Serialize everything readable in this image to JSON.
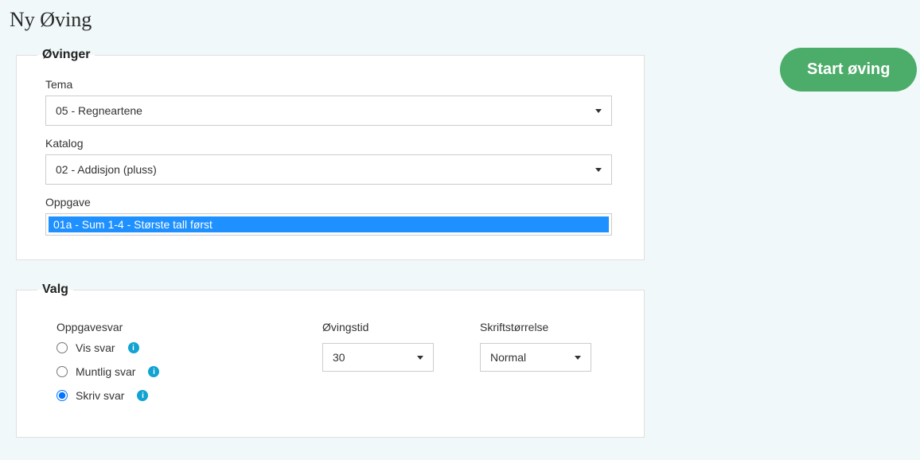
{
  "page": {
    "title": "Ny Øving"
  },
  "start_button": {
    "label": "Start øving"
  },
  "ovinger": {
    "legend": "Øvinger",
    "tema": {
      "label": "Tema",
      "value": "05 - Regneartene"
    },
    "katalog": {
      "label": "Katalog",
      "value": "02 - Addisjon (pluss)"
    },
    "oppgave": {
      "label": "Oppgave",
      "selected": "01a - Sum 1-4 - Største tall først"
    }
  },
  "valg": {
    "legend": "Valg",
    "oppgavesvar": {
      "heading": "Oppgavesvar",
      "options": {
        "vis": "Vis svar",
        "muntlig": "Muntlig svar",
        "skriv": "Skriv svar"
      },
      "selected": "skriv"
    },
    "ovingstid": {
      "label": "Øvingstid",
      "value": "30"
    },
    "skriftstorrelse": {
      "label": "Skriftstørrelse",
      "value": "Normal"
    }
  }
}
